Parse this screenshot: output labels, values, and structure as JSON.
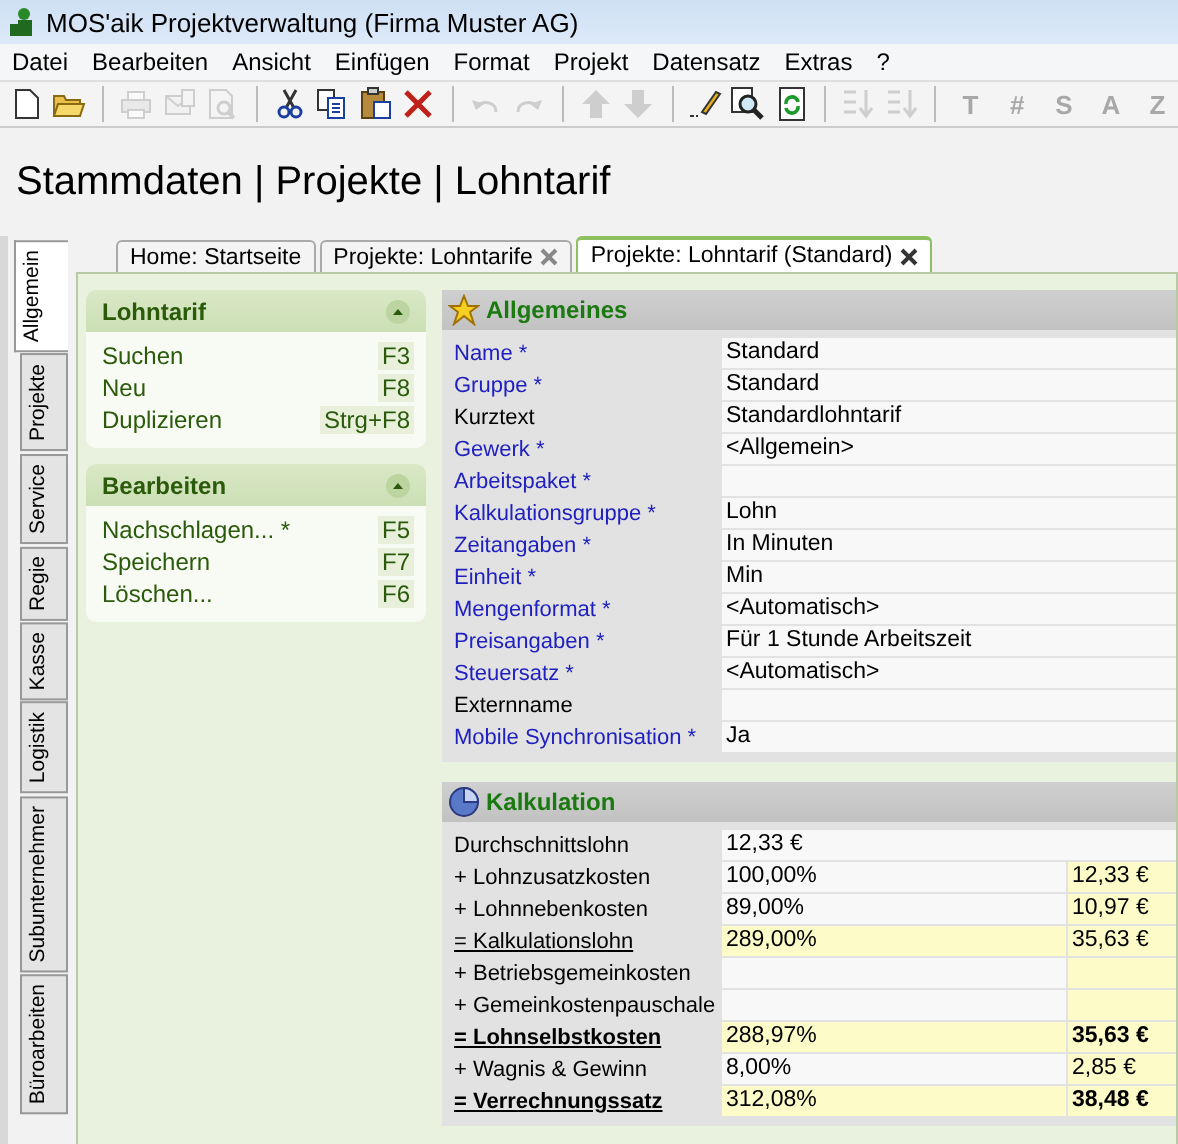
{
  "window": {
    "title": "MOS'aik Projektverwaltung (Firma Muster AG)"
  },
  "menu": [
    "Datei",
    "Bearbeiten",
    "Ansicht",
    "Einfügen",
    "Format",
    "Projekt",
    "Datensatz",
    "Extras",
    "?"
  ],
  "toolbar": [
    {
      "kind": "new",
      "disabled": false
    },
    {
      "kind": "open",
      "disabled": false
    },
    {
      "kind": "separator"
    },
    {
      "kind": "print",
      "disabled": true
    },
    {
      "kind": "mail",
      "disabled": true
    },
    {
      "kind": "preview",
      "disabled": true
    },
    {
      "kind": "separator"
    },
    {
      "kind": "cut",
      "disabled": false
    },
    {
      "kind": "copy",
      "disabled": false
    },
    {
      "kind": "paste",
      "disabled": false
    },
    {
      "kind": "delete",
      "disabled": false
    },
    {
      "kind": "separator"
    },
    {
      "kind": "undo",
      "disabled": true
    },
    {
      "kind": "redo",
      "disabled": true
    },
    {
      "kind": "separator"
    },
    {
      "kind": "up",
      "disabled": true
    },
    {
      "kind": "down",
      "disabled": true
    },
    {
      "kind": "separator"
    },
    {
      "kind": "edit",
      "disabled": false
    },
    {
      "kind": "find",
      "disabled": false
    },
    {
      "kind": "refresh",
      "disabled": false
    },
    {
      "kind": "separator"
    },
    {
      "kind": "sort-asc",
      "disabled": true
    },
    {
      "kind": "sort-desc",
      "disabled": true
    },
    {
      "kind": "separator"
    },
    {
      "kind": "letter",
      "label": "T",
      "disabled": true
    },
    {
      "kind": "letter",
      "label": "#",
      "disabled": true
    },
    {
      "kind": "letter",
      "label": "S",
      "disabled": true
    },
    {
      "kind": "letter",
      "label": "A",
      "disabled": true
    },
    {
      "kind": "letter",
      "label": "Z",
      "disabled": true
    }
  ],
  "heading": "Stammdaten | Projekte | Lohntarif",
  "side_tabs": [
    {
      "label": "Allgemein",
      "selected": true
    },
    {
      "label": "Projekte",
      "selected": false
    },
    {
      "label": "Service",
      "selected": false
    },
    {
      "label": "Regie",
      "selected": false
    },
    {
      "label": "Kasse",
      "selected": false
    },
    {
      "label": "Logistik",
      "selected": false
    },
    {
      "label": "Subunternehmer",
      "selected": false
    },
    {
      "label": "Büroarbeiten",
      "selected": false
    }
  ],
  "tabs": [
    {
      "label": "Home: Startseite",
      "selected": false,
      "closable": false
    },
    {
      "label": "Projekte: Lohntarife",
      "selected": false,
      "closable": true
    },
    {
      "label": "Projekte: Lohntarif (Standard)",
      "selected": true,
      "closable": true
    }
  ],
  "tasks": [
    {
      "title": "Lohntarif",
      "items": [
        {
          "label": "Suchen",
          "shortcut": "F3"
        },
        {
          "label": "Neu",
          "shortcut": "F8"
        },
        {
          "label": "Duplizieren",
          "shortcut": "Strg+F8"
        }
      ]
    },
    {
      "title": "Bearbeiten",
      "items": [
        {
          "label": "Nachschlagen... *",
          "shortcut": "F5"
        },
        {
          "label": "Speichern",
          "shortcut": "F7"
        },
        {
          "label": "Löschen...",
          "shortcut": "F6"
        }
      ]
    }
  ],
  "general": {
    "title": "Allgemeines",
    "fields": [
      {
        "label": "Name *",
        "required": true,
        "value": "Standard"
      },
      {
        "label": "Gruppe *",
        "required": true,
        "value": "Standard"
      },
      {
        "label": "Kurztext",
        "required": false,
        "value": "Standardlohntarif"
      },
      {
        "label": "Gewerk *",
        "required": true,
        "value": "<Allgemein>"
      },
      {
        "label": "Arbeitspaket *",
        "required": true
      },
      {
        "label": "Kalkulationsgruppe *",
        "required": true,
        "value": "Lohn"
      },
      {
        "label": "Zeitangaben *",
        "required": true,
        "value": "In Minuten"
      },
      {
        "label": "Einheit *",
        "required": true,
        "value": "Min"
      },
      {
        "label": "Mengenformat *",
        "required": true,
        "value": "<Automatisch>"
      },
      {
        "label": "Preisangaben *",
        "required": true,
        "value": "Für 1 Stunde Arbeitszeit"
      },
      {
        "label": "Steuersatz *",
        "required": true,
        "value": "<Automatisch>"
      },
      {
        "label": "Externname",
        "required": false
      },
      {
        "label": "Mobile Synchronisation *",
        "required": true,
        "value": "Ja"
      }
    ]
  },
  "calculation": {
    "title": "Kalkulation",
    "rows": [
      {
        "kind": "single",
        "label": "Durchschnittslohn",
        "value": "12,33 €"
      },
      {
        "kind": "split",
        "label": "+ Lohnzusatzkosten",
        "percent": "100,00%",
        "amount": "12,33 €",
        "highlight": false,
        "underlined": false,
        "bold": false
      },
      {
        "kind": "split",
        "label": "+ Lohnnebenkosten",
        "percent": "89,00%",
        "amount": "10,97 €",
        "highlight": false,
        "underlined": false,
        "bold": false
      },
      {
        "kind": "split",
        "label": "= Kalkulationslohn",
        "percent": "289,00%",
        "amount": "35,63 €",
        "highlight": true,
        "underlined": true,
        "bold": false
      },
      {
        "kind": "split",
        "label": "+ Betriebsgemeinkosten",
        "highlight": false,
        "underlined": false,
        "bold": false
      },
      {
        "kind": "split",
        "label": "+ Gemeinkostenpauschale",
        "highlight": false,
        "underlined": false,
        "bold": false
      },
      {
        "kind": "split",
        "label": "= Lohnselbstkosten",
        "percent": "288,97%",
        "amount": "35,63 €",
        "highlight": true,
        "underlined": true,
        "bold": true
      },
      {
        "kind": "split",
        "label": "+ Wagnis & Gewinn",
        "percent": "8,00%",
        "amount": "2,85 €",
        "highlight": false,
        "underlined": false,
        "bold": false
      },
      {
        "kind": "split",
        "label": "= Verrechnungssatz",
        "percent": "312,08%",
        "amount": "38,48 €",
        "highlight": true,
        "underlined": true,
        "bold": true
      }
    ]
  }
}
